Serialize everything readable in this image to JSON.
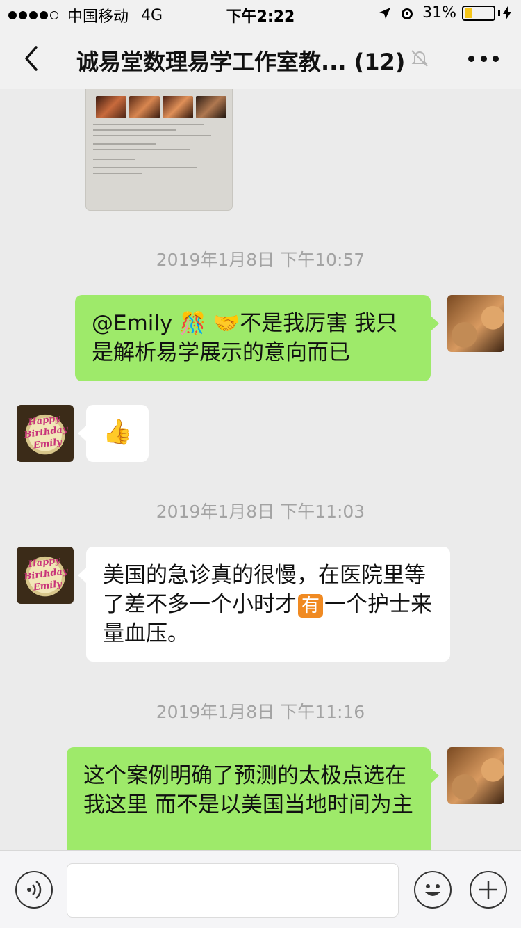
{
  "status_bar": {
    "carrier": "中国移动",
    "network": "4G",
    "time": "下午2:22",
    "battery": "31%",
    "battery_level": 0.31
  },
  "nav": {
    "title": "诚易堂数理易学工作室教...",
    "member_count": "(12)"
  },
  "messages": [
    {
      "type": "timestamp",
      "text": "2019年1月8日 下午10:57"
    },
    {
      "type": "outgoing",
      "avatar": "carving-avatar",
      "text_before": "@Emily 🎊 🤝不是我厉害 我只是解析易学展示的意向而已"
    },
    {
      "type": "incoming",
      "avatar": "birthday-cake-avatar",
      "avatar_text": "Happy Birthday Emily",
      "text": "👍"
    },
    {
      "type": "timestamp",
      "text": "2019年1月8日 下午11:03"
    },
    {
      "type": "incoming",
      "avatar": "birthday-cake-avatar",
      "avatar_text": "Happy Birthday Emily",
      "text_before": "美国的急诊真的很慢，在医院里等了差不多一个小时才",
      "emoji": "有",
      "text_after": "一个护士来量血压。"
    },
    {
      "type": "timestamp",
      "text": "2019年1月8日 下午11:16"
    },
    {
      "type": "outgoing",
      "avatar": "carving-avatar",
      "text": "这个案例明确了预测的太极点选在我这里 而不是以美国当地时间为主"
    }
  ],
  "input_bar": {
    "placeholder": ""
  },
  "colors": {
    "outgoing_bubble": "#9eea6a",
    "incoming_bubble": "#ffffff",
    "background": "#ebebeb"
  }
}
